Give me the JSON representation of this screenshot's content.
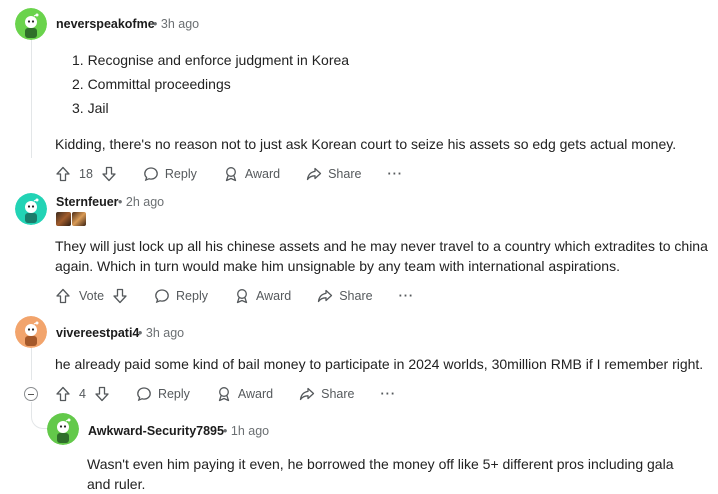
{
  "comments": [
    {
      "username": "neverspeakofme",
      "time": "3h ago",
      "list_items": [
        "1. Recognise and enforce judgment in Korea",
        "2. Committal proceedings",
        "3. Jail"
      ],
      "text": "Kidding, there's no reason not to just ask Korean court to seize his assets so edg gets actual money.",
      "votes": "18",
      "avatar_color": "#6ad34c"
    },
    {
      "username": "Sternfeuer",
      "time": "2h ago",
      "text": "They will just lock up all his chinese assets and he may never travel to a country which extradites to china again. Which in turn would make him unsignable by any team with international aspirations.",
      "votes": "Vote",
      "avatar_color": "#22d3b5"
    },
    {
      "username": "vivereestpati4",
      "time": "3h ago",
      "text": "he already paid some kind of bail money to participate in 2024 worlds, 30million RMB if I remember right.",
      "votes": "4",
      "avatar_color": "#f2a46c"
    },
    {
      "username": "Awkward-Security7895",
      "time": "1h ago",
      "text": "Wasn't even him paying it even, he borrowed the money off like 5+ different pros including gala and ruler.",
      "avatar_color": "#63c94a"
    }
  ],
  "actions": {
    "reply": "Reply",
    "award": "Award",
    "share": "Share",
    "more": "···"
  },
  "separator": "•",
  "icons": [
    "upvote-icon",
    "downvote-icon",
    "reply-icon",
    "award-icon",
    "share-icon",
    "more-icon",
    "collapse-icon"
  ]
}
